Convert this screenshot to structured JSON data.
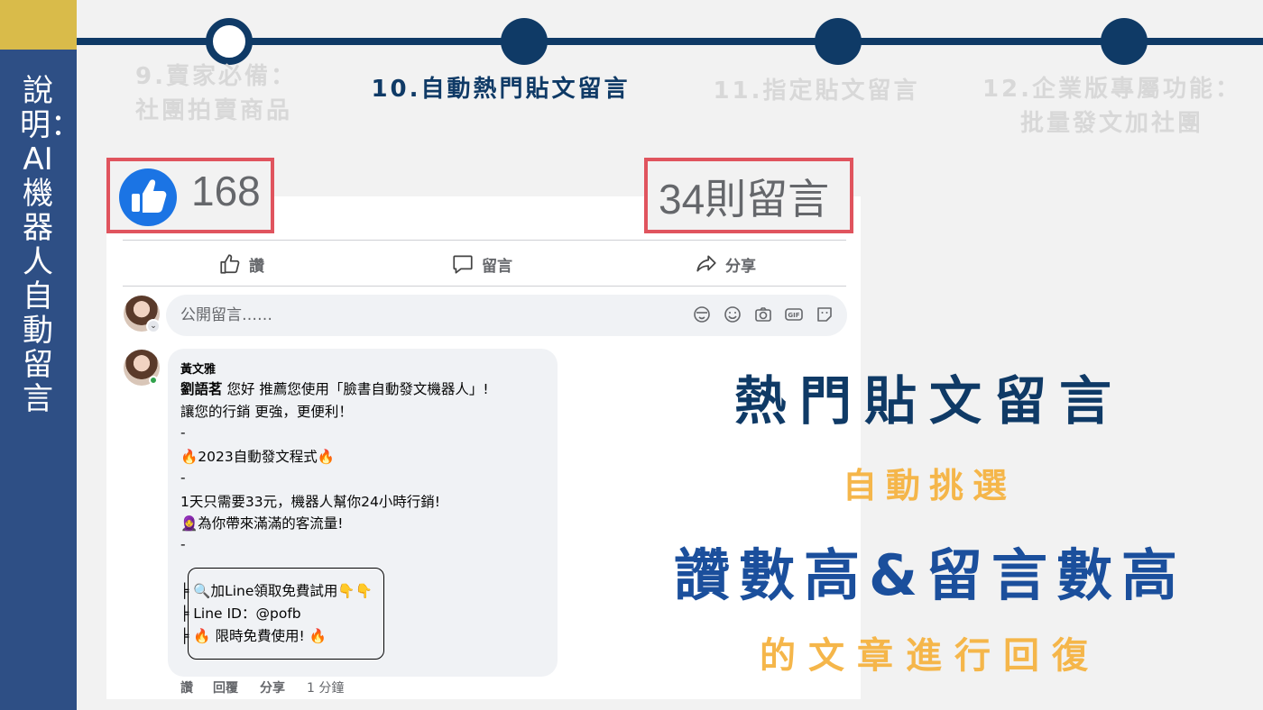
{
  "sidebar": {
    "title": "說明：AI機器人自動留言"
  },
  "steps": [
    {
      "line1": "9.賣家必備：",
      "line2": "社團拍賣商品"
    },
    {
      "line1": "10.自動熱門貼文留言",
      "line2": ""
    },
    {
      "line1": "11.指定貼文留言",
      "line2": ""
    },
    {
      "line1": "12.企業版專屬功能：",
      "line2": "批量發文加社團"
    }
  ],
  "post": {
    "like_count": "168",
    "comment_count": "34則留言",
    "actions": {
      "like": "讚",
      "comment": "留言",
      "share": "分享"
    },
    "comment_placeholder": "公開留言……"
  },
  "comment": {
    "author": "黃文雅",
    "mention": "劉語茗",
    "line1_rest": " 您好 推薦您使用「臉書自動發文機器人」!",
    "line2": "讓您的行銷 更強，更便利！",
    "sep1": "-",
    "line3": "🔥2023自動發文程式🔥",
    "sep2": "-",
    "line4": "1天只需要33元，機器人幫你24小時行銷!",
    "line5": "🧕為你帶來滿滿的客流量!",
    "sep3": "-",
    "box1": "╞ 🔍加Line領取免費試用👇👇",
    "box2": "╞ Line ID：@pofb",
    "box3": "╞ 🔥 限時免費使用! 🔥",
    "footer": {
      "like": "讚",
      "reply": "回覆",
      "share": "分享",
      "time": "1 分鐘"
    }
  },
  "headlines": {
    "h1": "熱門貼文留言",
    "h2": "自動挑選",
    "h3": "讚數高&留言數高",
    "h4": "的文章進行回復"
  },
  "colors": {
    "navy": "#0f3a66",
    "sidebar_blue": "#2e4f85",
    "gold": "#d9bb4a",
    "orange": "#f5b64a",
    "highlight_red": "#e0545e",
    "facebook_blue": "#1b74e4"
  }
}
